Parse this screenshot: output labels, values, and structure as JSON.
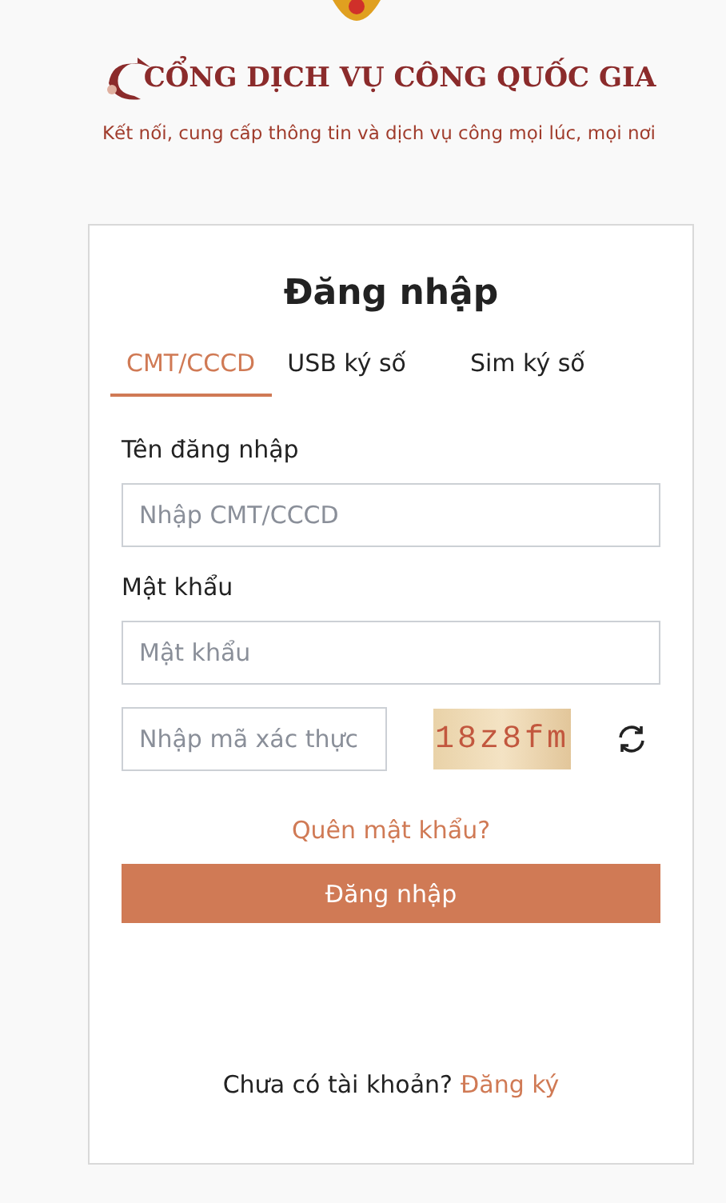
{
  "header": {
    "title": "CỔNG DỊCH VỤ CÔNG QUỐC GIA",
    "subtitle": "Kết nối, cung cấp thông tin và dịch vụ công mọi lúc, mọi nơi"
  },
  "login": {
    "heading": "Đăng nhập",
    "tabs": [
      {
        "label": "CMT/CCCD",
        "selected": true
      },
      {
        "label": "USB ký số",
        "selected": false
      },
      {
        "label": "Sim ký số",
        "selected": false
      }
    ],
    "username": {
      "label": "Tên đăng nhập",
      "placeholder": "Nhập CMT/CCCD"
    },
    "password": {
      "label": "Mật khẩu",
      "placeholder": "Mật khẩu"
    },
    "captcha": {
      "placeholder": "Nhập mã xác thực",
      "code": "18z8fm"
    },
    "forgot_link": "Quên mật khẩu?",
    "submit": "Đăng nhập",
    "footer": {
      "text": "Chưa có tài khoản?",
      "link": "Đăng ký"
    }
  }
}
